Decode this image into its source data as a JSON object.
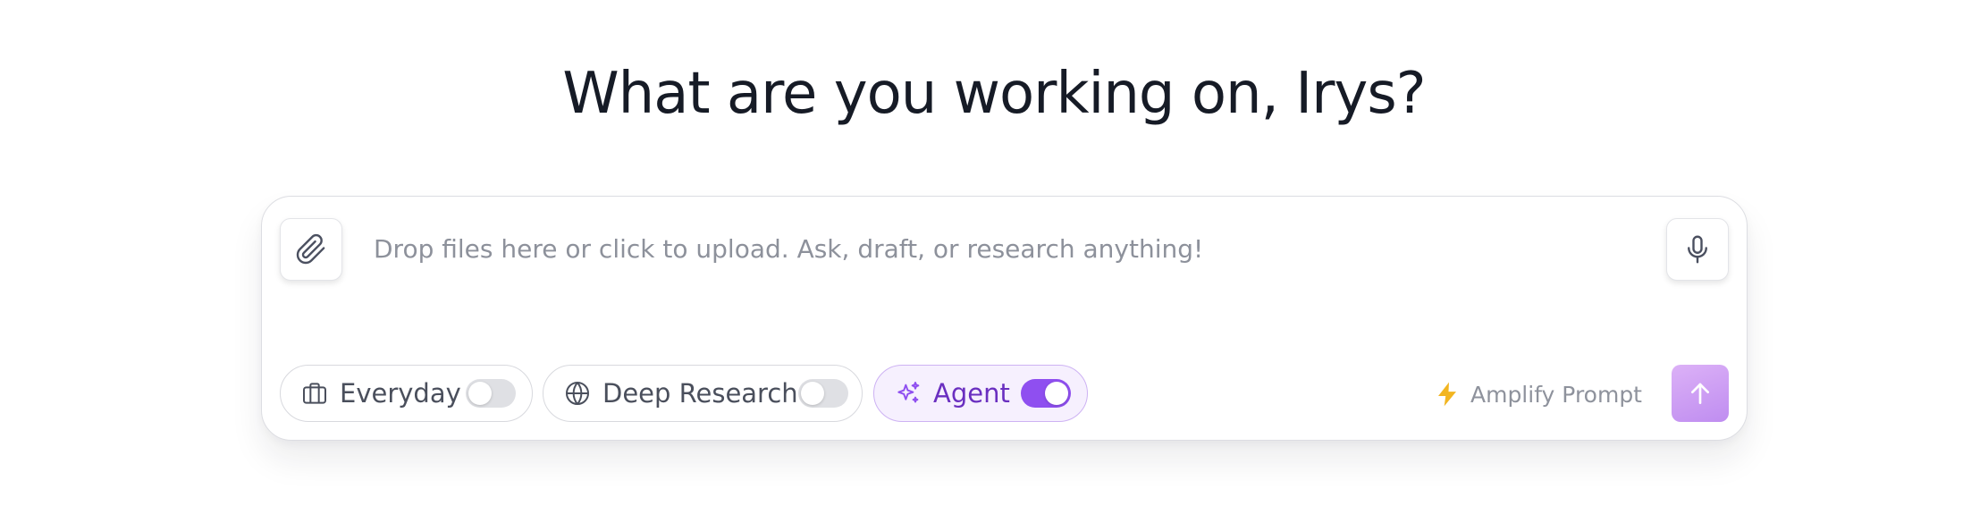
{
  "heading": "What are you working on, Irys?",
  "composer": {
    "placeholder": "Drop files here or click to upload. Ask, draft, or research anything!",
    "value": ""
  },
  "modes": [
    {
      "label": "Everyday",
      "icon": "briefcase-icon",
      "enabled": false
    },
    {
      "label": "Deep Research",
      "icon": "globe-icon",
      "enabled": false
    },
    {
      "label": "Agent",
      "icon": "sparkles-icon",
      "enabled": true
    }
  ],
  "amplify": {
    "label": "Amplify Prompt",
    "icon": "lightning-bolt-icon"
  },
  "icons": {
    "attach": "paperclip-icon",
    "mic": "microphone-icon",
    "send": "arrow-up-icon"
  },
  "colors": {
    "heading": "#161b26",
    "accent": "#8f4ff0",
    "agent_bg": "#f6f0fe",
    "agent_text": "#6a2fc0",
    "bolt": "#f2b520",
    "send_gradient_start": "#dcb1f7",
    "send_gradient_end": "#bf8df0"
  }
}
